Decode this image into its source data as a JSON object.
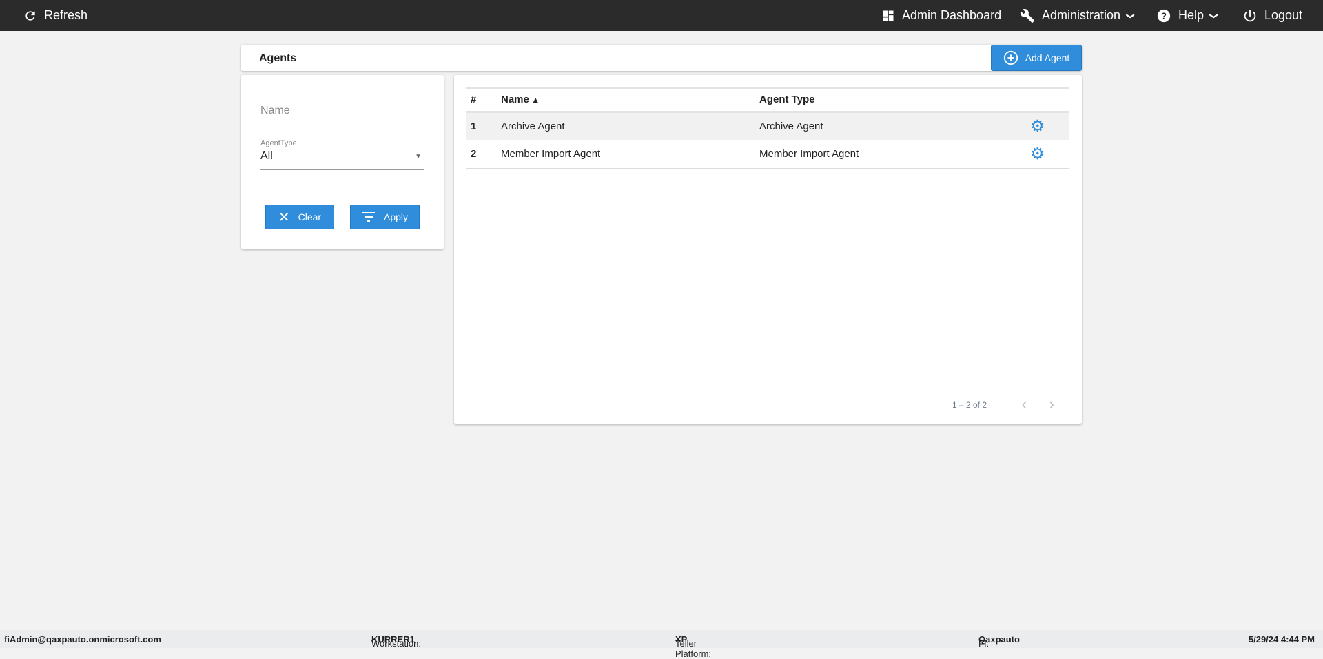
{
  "nav": {
    "refresh": "Refresh",
    "admin_dashboard": "Admin Dashboard",
    "administration": "Administration",
    "help": "Help",
    "logout": "Logout"
  },
  "header": {
    "title": "Agents",
    "add_button": "Add Agent"
  },
  "filter": {
    "name_placeholder": "Name",
    "agent_type_label": "AgentType",
    "agent_type_value": "All",
    "clear": "Clear",
    "apply": "Apply"
  },
  "table": {
    "columns": [
      "#",
      "Name",
      "Agent Type"
    ],
    "rows": [
      {
        "num": "1",
        "name": "Archive Agent",
        "type": "Archive Agent"
      },
      {
        "num": "2",
        "name": "Member Import Agent",
        "type": "Member Import Agent"
      }
    ]
  },
  "pagination": {
    "range": "1 – 2 of 2"
  },
  "footer": {
    "user": "fiAdmin@qaxpauto.onmicrosoft.com",
    "workstation_label": "Workstation: ",
    "workstation": "KURRER1",
    "platform_label": "Teller Platform: ",
    "platform": "XP",
    "fi_label": "FI: ",
    "fi": "Qaxpauto",
    "datetime": "5/29/24 4:44 PM"
  },
  "colors": {
    "accent": "#2f8ddb",
    "nav_bg": "#2b2b2b"
  }
}
